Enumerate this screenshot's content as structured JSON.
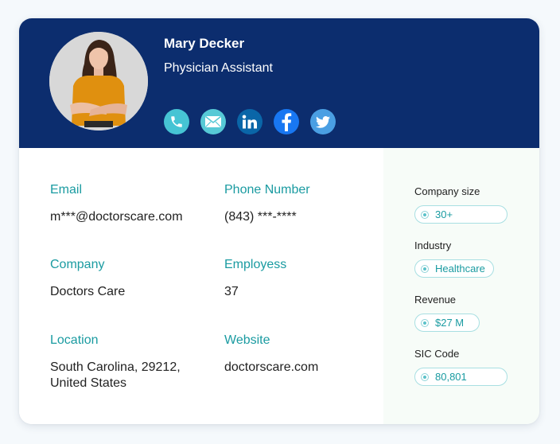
{
  "profile": {
    "name": "Mary Decker",
    "title": "Physician Assistant",
    "avatar_alt": "profile-photo"
  },
  "socials": [
    {
      "icon": "phone-icon",
      "color": "#46c4d4"
    },
    {
      "icon": "email-icon",
      "color": "#56c9d6"
    },
    {
      "icon": "linkedin-icon",
      "color": "#0a66a8"
    },
    {
      "icon": "facebook-icon",
      "color": "#1877f2"
    },
    {
      "icon": "twitter-icon",
      "color": "#4a9fe3"
    }
  ],
  "details": {
    "email": {
      "label": "Email",
      "value": "m***@doctorscare.com"
    },
    "phone": {
      "label": "Phone Number",
      "value": "(843) ***-****"
    },
    "company": {
      "label": "Company",
      "value": "Doctors Care"
    },
    "employees": {
      "label": "Employess",
      "value": "37"
    },
    "location": {
      "label": "Location",
      "value": "South Carolina, 29212, United States"
    },
    "website": {
      "label": "Website",
      "value": "doctorscare.com"
    }
  },
  "sidebar": {
    "company_size": {
      "label": "Company size",
      "value": "30+"
    },
    "industry": {
      "label": "Industry",
      "value": "Healthcare"
    },
    "revenue": {
      "label": "Revenue",
      "value": "$27 M"
    },
    "sic_code": {
      "label": "SIC Code",
      "value": "80,801"
    }
  },
  "colors": {
    "header_bg": "#0c2d6e",
    "accent": "#1a9ba1",
    "side_bg": "#f7fcf8",
    "page_bg": "#f5f9fc"
  }
}
